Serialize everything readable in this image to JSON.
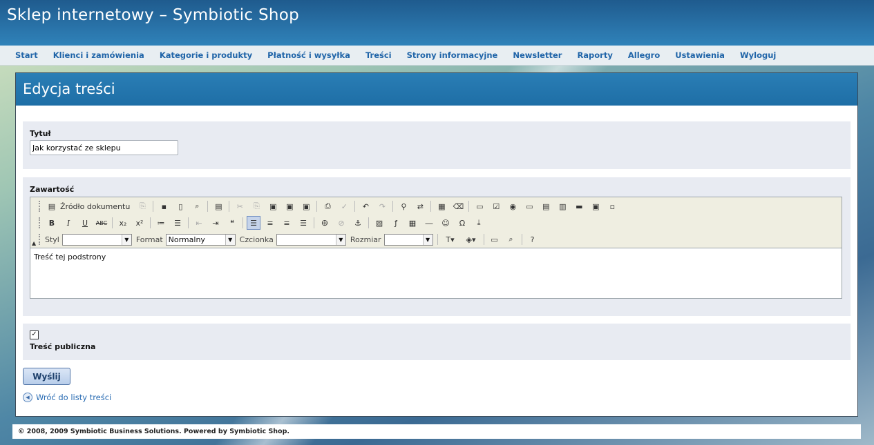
{
  "site_title": "Sklep internetowy – Symbiotic Shop",
  "nav": {
    "items": [
      "Start",
      "Klienci i zamówienia",
      "Kategorie i produkty",
      "Płatność i wysyłka",
      "Treści",
      "Strony informacyjne",
      "Newsletter",
      "Raporty",
      "Allegro",
      "Ustawienia",
      "Wyloguj"
    ]
  },
  "panel": {
    "title": "Edycja treści"
  },
  "form": {
    "title_label": "Tytuł",
    "title_value": "Jak korzystać ze sklepu",
    "content_label": "Zawartość",
    "public_label": "Treść publiczna",
    "public_checked": true,
    "submit_label": "Wyślij",
    "back_link": "Wróć do listy treści"
  },
  "editor": {
    "source_button": "Źródło dokumentu",
    "style_label": "Styl",
    "style_value": "",
    "format_label": "Format",
    "format_value": "Normalny",
    "font_label": "Czcionka",
    "font_value": "",
    "size_label": "Rozmiar",
    "size_value": "",
    "content_text": "Treść tej podstrony"
  },
  "footer": "© 2008, 2009 Symbiotic Business Solutions. Powered by Symbiotic Shop."
}
